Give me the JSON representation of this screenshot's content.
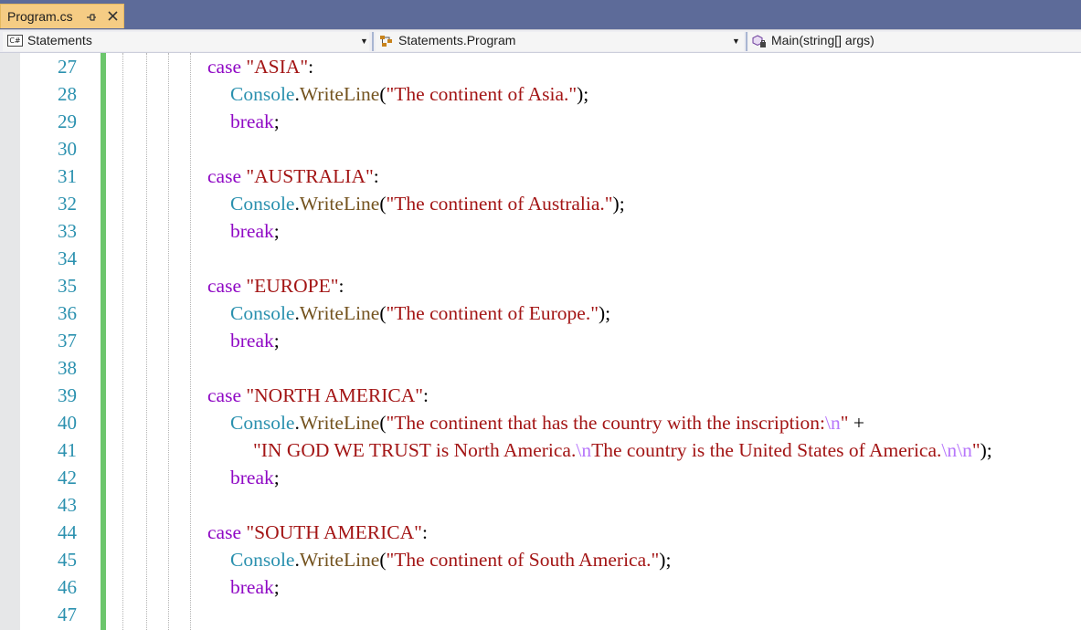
{
  "tab": {
    "title": "Program.cs",
    "pin_icon": "pin-icon",
    "close_icon": "close-icon"
  },
  "navbar": {
    "project": {
      "badge": "C#",
      "label": "Statements"
    },
    "type": {
      "label": "Statements.Program"
    },
    "member": {
      "label": "Main(string[] args)"
    }
  },
  "editor": {
    "line_numbers": [
      "27",
      "28",
      "29",
      "30",
      "31",
      "32",
      "33",
      "34",
      "35",
      "36",
      "37",
      "38",
      "39",
      "40",
      "41",
      "42",
      "43",
      "44",
      "45",
      "46",
      "47"
    ],
    "lines": [
      {
        "indent": 1,
        "tokens": [
          {
            "t": "case",
            "c": "kw"
          },
          {
            "t": " ",
            "c": "pn"
          },
          {
            "t": "\"ASIA\"",
            "c": "str"
          },
          {
            "t": ":",
            "c": "pn"
          }
        ]
      },
      {
        "indent": 2,
        "tokens": [
          {
            "t": "Console",
            "c": "cls"
          },
          {
            "t": ".",
            "c": "pn"
          },
          {
            "t": "WriteLine",
            "c": "mth"
          },
          {
            "t": "(",
            "c": "pn"
          },
          {
            "t": "\"The continent of Asia.\"",
            "c": "str"
          },
          {
            "t": ");",
            "c": "pn"
          }
        ]
      },
      {
        "indent": 2,
        "tokens": [
          {
            "t": "break",
            "c": "kw"
          },
          {
            "t": ";",
            "c": "pn"
          }
        ]
      },
      {
        "indent": 0,
        "tokens": []
      },
      {
        "indent": 1,
        "tokens": [
          {
            "t": "case",
            "c": "kw"
          },
          {
            "t": " ",
            "c": "pn"
          },
          {
            "t": "\"AUSTRALIA\"",
            "c": "str"
          },
          {
            "t": ":",
            "c": "pn"
          }
        ]
      },
      {
        "indent": 2,
        "tokens": [
          {
            "t": "Console",
            "c": "cls"
          },
          {
            "t": ".",
            "c": "pn"
          },
          {
            "t": "WriteLine",
            "c": "mth"
          },
          {
            "t": "(",
            "c": "pn"
          },
          {
            "t": "\"The continent of Australia.\"",
            "c": "str"
          },
          {
            "t": ");",
            "c": "pn"
          }
        ]
      },
      {
        "indent": 2,
        "tokens": [
          {
            "t": "break",
            "c": "kw"
          },
          {
            "t": ";",
            "c": "pn"
          }
        ]
      },
      {
        "indent": 0,
        "tokens": []
      },
      {
        "indent": 1,
        "tokens": [
          {
            "t": "case",
            "c": "kw"
          },
          {
            "t": " ",
            "c": "pn"
          },
          {
            "t": "\"EUROPE\"",
            "c": "str"
          },
          {
            "t": ":",
            "c": "pn"
          }
        ]
      },
      {
        "indent": 2,
        "tokens": [
          {
            "t": "Console",
            "c": "cls"
          },
          {
            "t": ".",
            "c": "pn"
          },
          {
            "t": "WriteLine",
            "c": "mth"
          },
          {
            "t": "(",
            "c": "pn"
          },
          {
            "t": "\"The continent of Europe.\"",
            "c": "str"
          },
          {
            "t": ");",
            "c": "pn"
          }
        ]
      },
      {
        "indent": 2,
        "tokens": [
          {
            "t": "break",
            "c": "kw"
          },
          {
            "t": ";",
            "c": "pn"
          }
        ]
      },
      {
        "indent": 0,
        "tokens": []
      },
      {
        "indent": 1,
        "tokens": [
          {
            "t": "case",
            "c": "kw"
          },
          {
            "t": " ",
            "c": "pn"
          },
          {
            "t": "\"NORTH AMERICA\"",
            "c": "str"
          },
          {
            "t": ":",
            "c": "pn"
          }
        ]
      },
      {
        "indent": 2,
        "tokens": [
          {
            "t": "Console",
            "c": "cls"
          },
          {
            "t": ".",
            "c": "pn"
          },
          {
            "t": "WriteLine",
            "c": "mth"
          },
          {
            "t": "(",
            "c": "pn"
          },
          {
            "t": "\"The continent that has the country with the inscription:",
            "c": "str"
          },
          {
            "t": "\\n",
            "c": "esc"
          },
          {
            "t": "\"",
            "c": "str"
          },
          {
            "t": " +",
            "c": "pn"
          }
        ]
      },
      {
        "indent": 3,
        "tokens": [
          {
            "t": "\"IN GOD WE TRUST is North America.",
            "c": "str"
          },
          {
            "t": "\\n",
            "c": "esc"
          },
          {
            "t": "The country is the United States of America.",
            "c": "str"
          },
          {
            "t": "\\n\\n",
            "c": "esc"
          },
          {
            "t": "\"",
            "c": "str"
          },
          {
            "t": ");",
            "c": "pn"
          }
        ]
      },
      {
        "indent": 2,
        "tokens": [
          {
            "t": "break",
            "c": "kw"
          },
          {
            "t": ";",
            "c": "pn"
          }
        ]
      },
      {
        "indent": 0,
        "tokens": []
      },
      {
        "indent": 1,
        "tokens": [
          {
            "t": "case",
            "c": "kw"
          },
          {
            "t": " ",
            "c": "pn"
          },
          {
            "t": "\"SOUTH AMERICA\"",
            "c": "str"
          },
          {
            "t": ":",
            "c": "pn"
          }
        ]
      },
      {
        "indent": 2,
        "tokens": [
          {
            "t": "Console",
            "c": "cls"
          },
          {
            "t": ".",
            "c": "pn"
          },
          {
            "t": "WriteLine",
            "c": "mth"
          },
          {
            "t": "(",
            "c": "pn"
          },
          {
            "t": "\"The continent of South America.\"",
            "c": "str"
          },
          {
            "t": ");",
            "c": "pn"
          }
        ]
      },
      {
        "indent": 2,
        "tokens": [
          {
            "t": "break",
            "c": "kw"
          },
          {
            "t": ";",
            "c": "pn"
          }
        ]
      },
      {
        "indent": 0,
        "tokens": []
      }
    ]
  },
  "colors": {
    "keyword": "#8f08c4",
    "class": "#2b91af",
    "method": "#74531f",
    "string": "#a31515",
    "escape": "#b776fb",
    "line_number": "#2b91af",
    "change_bar": "#6cc66c",
    "active_tab": "#f5cc84",
    "tab_strip": "#5d6b99"
  }
}
